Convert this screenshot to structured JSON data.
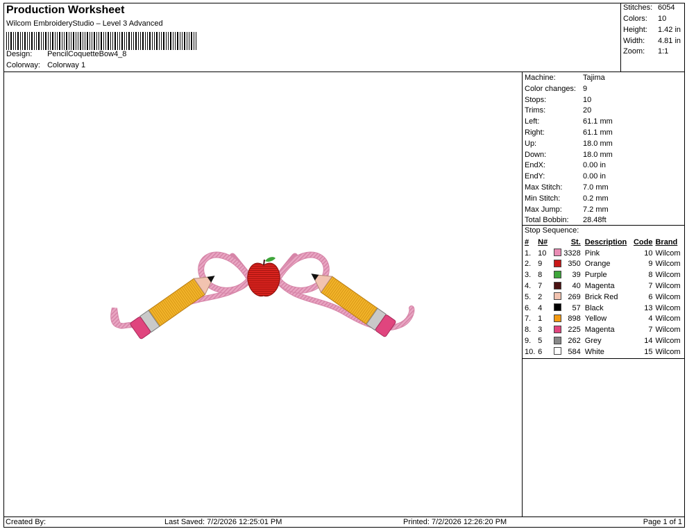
{
  "header": {
    "title": "Production Worksheet",
    "software": "Wilcom EmbroideryStudio – Level 3 Advanced",
    "design_label": "Design:",
    "design_value": "PencilCoquetteBow4_8",
    "colorway_label": "Colorway:",
    "colorway_value": "Colorway 1"
  },
  "summary": {
    "stitches_label": "Stitches:",
    "stitches_value": "6054",
    "colors_label": "Colors:",
    "colors_value": "10",
    "height_label": "Height:",
    "height_value": "1.42 in",
    "width_label": "Width:",
    "width_value": "4.81 in",
    "zoom_label": "Zoom:",
    "zoom_value": "1:1"
  },
  "specs": [
    {
      "label": "Machine:",
      "value": "Tajima"
    },
    {
      "label": "Color changes:",
      "value": "9"
    },
    {
      "label": "Stops:",
      "value": "10"
    },
    {
      "label": "Trims:",
      "value": "20"
    },
    {
      "label": "Left:",
      "value": "61.1 mm"
    },
    {
      "label": "Right:",
      "value": "61.1 mm"
    },
    {
      "label": "Up:",
      "value": "18.0 mm"
    },
    {
      "label": "Down:",
      "value": "18.0 mm"
    },
    {
      "label": "EndX:",
      "value": "0.00 in"
    },
    {
      "label": "EndY:",
      "value": "0.00 in"
    },
    {
      "label": "Max Stitch:",
      "value": "7.0 mm"
    },
    {
      "label": "Min Stitch:",
      "value": "0.2 mm"
    },
    {
      "label": "Max Jump:",
      "value": "7.2 mm"
    },
    {
      "label": "Total Bobbin:",
      "value": "28.48ft"
    }
  ],
  "stop_sequence": {
    "title": "Stop Sequence:",
    "headers": {
      "idx": "#",
      "n": "N#",
      "st": "St.",
      "description": "Description",
      "code": "Code",
      "brand": "Brand"
    },
    "rows": [
      {
        "idx": "1.",
        "n": "10",
        "color": "#e98cb4",
        "st": "3328",
        "description": "Pink",
        "code": "10",
        "brand": "Wilcom"
      },
      {
        "idx": "2.",
        "n": "9",
        "color": "#c81818",
        "st": "350",
        "description": "Orange",
        "code": "9",
        "brand": "Wilcom"
      },
      {
        "idx": "3.",
        "n": "8",
        "color": "#3ea53a",
        "st": "39",
        "description": "Purple",
        "code": "8",
        "brand": "Wilcom"
      },
      {
        "idx": "4.",
        "n": "7",
        "color": "#4a1212",
        "st": "40",
        "description": "Magenta",
        "code": "7",
        "brand": "Wilcom"
      },
      {
        "idx": "5.",
        "n": "2",
        "color": "#f2c3b0",
        "st": "269",
        "description": "Brick Red",
        "code": "6",
        "brand": "Wilcom"
      },
      {
        "idx": "6.",
        "n": "4",
        "color": "#000000",
        "st": "57",
        "description": "Black",
        "code": "13",
        "brand": "Wilcom"
      },
      {
        "idx": "7.",
        "n": "1",
        "color": "#f39a12",
        "st": "898",
        "description": "Yellow",
        "code": "4",
        "brand": "Wilcom"
      },
      {
        "idx": "8.",
        "n": "3",
        "color": "#e0457e",
        "st": "225",
        "description": "Magenta",
        "code": "7",
        "brand": "Wilcom"
      },
      {
        "idx": "9.",
        "n": "5",
        "color": "#888888",
        "st": "262",
        "description": "Grey",
        "code": "14",
        "brand": "Wilcom"
      },
      {
        "idx": "10.",
        "n": "6",
        "color": "#ffffff",
        "st": "584",
        "description": "White",
        "code": "15",
        "brand": "Wilcom"
      }
    ]
  },
  "footer": {
    "created_by": "Created By:",
    "last_saved": "Last Saved: 7/2/2026 12:25:01 PM",
    "printed": "Printed: 7/2/2026 12:26:20 PM",
    "page": "Page 1 of 1"
  }
}
